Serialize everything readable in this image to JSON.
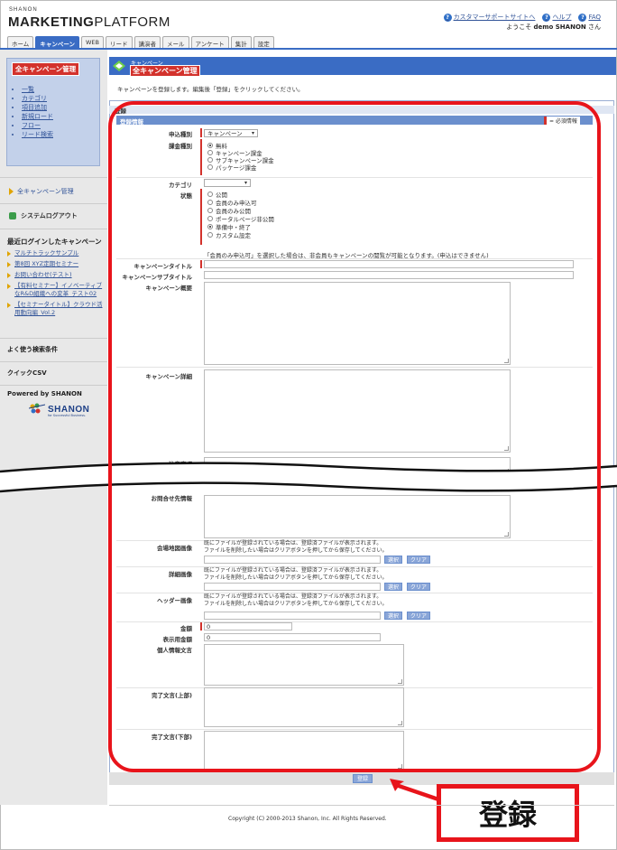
{
  "header": {
    "brand_small": "SHANON",
    "brand_pre": "MARKETING",
    "brand_post": "PLATFORM",
    "links": [
      "カスタマーサポートサイトへ",
      "ヘルプ",
      "FAQ"
    ],
    "welcome_pre": "ようこそ",
    "welcome_user": "demo SHANON",
    "welcome_post": "さん"
  },
  "tabs": [
    "ホーム",
    "キャンペーン",
    "WEB",
    "リード",
    "講演者",
    "メール",
    "アンケート",
    "集計",
    "設定"
  ],
  "sidebar": {
    "box_title": "全キャンペーン管理",
    "items": [
      "一覧",
      "カテゴリ",
      "項目追加",
      "新規ロード",
      "フロー",
      "リード検索"
    ],
    "manage_link": "全キャンペーン管理",
    "logout": "システムログアウト",
    "recent_title": "最近ログインしたキャンペーン",
    "recent": [
      "マルチトラックサンプル",
      "第8回 XYZ定期セミナー",
      "お問い合わせ(テスト)",
      "【有料セミナー】イノベーティブなR&D組織への変革_テスト02",
      "【セミナータイトル】クラウド活用動向編_Vol.2"
    ],
    "search_conditions": "よく使う検索条件",
    "quick_csv": "クイックCSV",
    "powered": "Powered by SHANON",
    "logo_text": "SHANON",
    "logo_sub": "for Successful Business."
  },
  "main": {
    "head_small": "キャンペーン",
    "head_title": "全キャンペーン管理",
    "intro": "キャンペーンを登録します。編集後「登録」をクリックしてください。",
    "form_label": "登録",
    "section_label": "登録情報",
    "required_key": "= 必須情報"
  },
  "form": {
    "apply_type_label": "申込種別",
    "apply_type_value": "キャンペーン",
    "billing_label": "課金種別",
    "billing_options": [
      "無料",
      "キャンペーン課金",
      "サブキャンペーン課金",
      "パッケージ課金"
    ],
    "billing_selected": 0,
    "category_label": "カテゴリ",
    "status_label": "状態",
    "status_options": [
      "公開",
      "会員のみ申込可",
      "会員のみ公開",
      "ポータルページ非公開",
      "準備中・終了",
      "カスタム設定"
    ],
    "status_selected": 4,
    "status_note": "「会員のみ申込可」を選択した場合は、非会員もキャンペーンの閲覧が可能となります。(申込はできません)",
    "title_label": "キャンペーンタイトル",
    "subtitle_label": "キャンペーンサブタイトル",
    "overview_label": "キャンペーン概要",
    "detail_label": "キャンペーン詳細",
    "notes_label": "注意事項",
    "partial_label": "お問合せ先情報",
    "venue_map_label": "会場地図画像",
    "detail_image_label": "詳細画像",
    "header_image_label": "ヘッダー画像",
    "file_note_1": "既にファイルが登録されている場合は、登録済ファイルが表示されます。",
    "file_note_2": "ファイルを削除したい場合はクリアボタンを押してから保存してください。",
    "select_btn": "選択",
    "clear_btn": "クリア",
    "amount_label": "金額",
    "amount_value": "0",
    "display_amount_label": "表示用金額",
    "display_amount_value": "0",
    "privacy_label": "個人情報文言",
    "complete_upper_label": "完了文言(上部)",
    "complete_lower_label": "完了文言(下部)"
  },
  "submit": "登録",
  "callout": "登録",
  "footer": "Copyright (C) 2000-2013 Shanon, Inc. All Rights Reserved.",
  "colors": {
    "accent": "#3a6cc4",
    "highlight": "#e8141b",
    "required": "#d3322c"
  }
}
